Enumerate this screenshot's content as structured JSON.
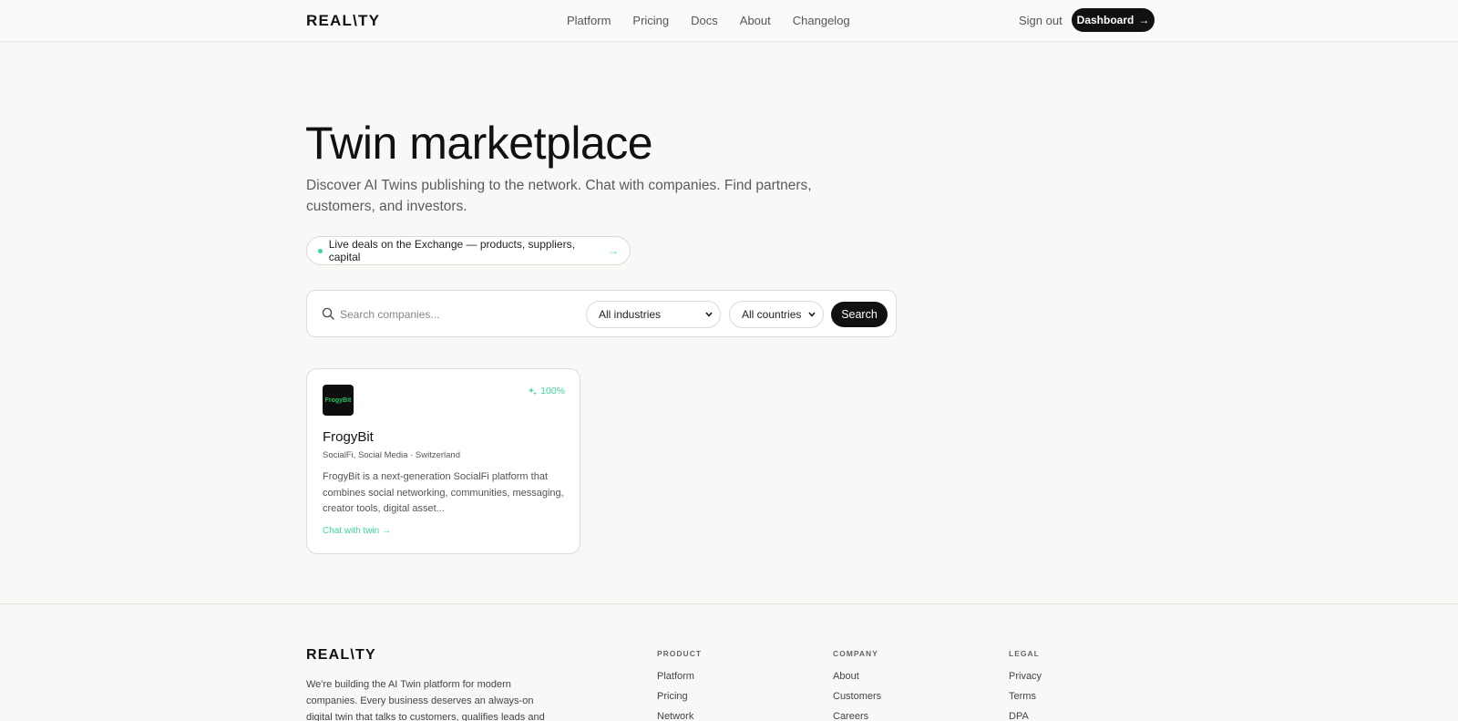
{
  "header": {
    "logo": "REAL\\TY",
    "nav": [
      "Platform",
      "Pricing",
      "Docs",
      "About",
      "Changelog"
    ],
    "sign_out": "Sign out",
    "dashboard": "Dashboard"
  },
  "hero": {
    "title": "Twin marketplace",
    "subtitle": "Discover AI Twins publishing to the network. Chat with companies. Find partners, customers, and investors.",
    "pill": "Live deals on the Exchange — products, suppliers, capital"
  },
  "search": {
    "placeholder": "Search companies...",
    "industry": "All industries",
    "country": "All countries",
    "button": "Search"
  },
  "card": {
    "logo_text": "FrogyBit",
    "score": "100%",
    "name": "FrogyBit",
    "meta": "SocialFi, Social Media · Switzerland",
    "description": "FrogyBit is a next-generation SocialFi platform that combines social networking, communities, messaging, creator tools, digital asset...",
    "link": "Chat with twin"
  },
  "footer": {
    "logo": "REAL\\TY",
    "tagline": "We're building the AI Twin platform for modern companies. Every business deserves an always-on digital twin that talks to customers, qualifies leads and",
    "product": {
      "heading": "PRODUCT",
      "links": [
        "Platform",
        "Pricing",
        "Network"
      ]
    },
    "company": {
      "heading": "COMPANY",
      "links": [
        "About",
        "Customers",
        "Careers"
      ]
    },
    "legal": {
      "heading": "LEGAL",
      "links": [
        "Privacy",
        "Terms",
        "DPA"
      ]
    }
  },
  "colors": {
    "accent": "#3ed6a0",
    "dark": "#111111",
    "background": "#f9f8f6"
  }
}
